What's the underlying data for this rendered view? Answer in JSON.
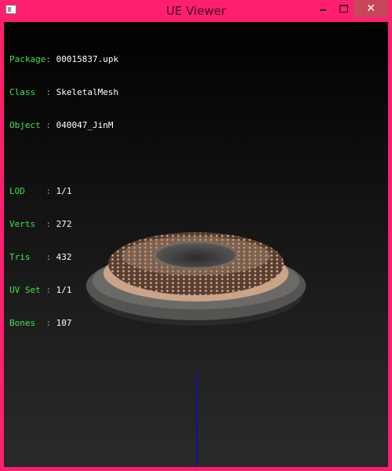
{
  "window": {
    "title": "UE Viewer",
    "close_symbol": "✕"
  },
  "info": {
    "object_rows": [
      {
        "label": "Package:",
        "value": "00015837.upk"
      },
      {
        "label": "Class  :",
        "value": "SkeletalMesh"
      },
      {
        "label": "Object :",
        "value": "040047_JinM"
      }
    ],
    "mesh_rows": [
      {
        "label": "LOD    :",
        "value": "1/1"
      },
      {
        "label": "Verts  :",
        "value": "272"
      },
      {
        "label": "Tris   :",
        "value": "432"
      },
      {
        "label": "UV Set :",
        "value": "1/1"
      },
      {
        "label": "Bones  :",
        "value": "107"
      }
    ]
  },
  "colors": {
    "label": "#45e24a",
    "value": "#ffffff",
    "frame": "#ff1f6e",
    "axis": "#1010a0"
  },
  "icons": {
    "app": "app-window-icon",
    "minimize": "minimize-icon",
    "maximize": "maximize-icon",
    "close": "close-icon"
  }
}
